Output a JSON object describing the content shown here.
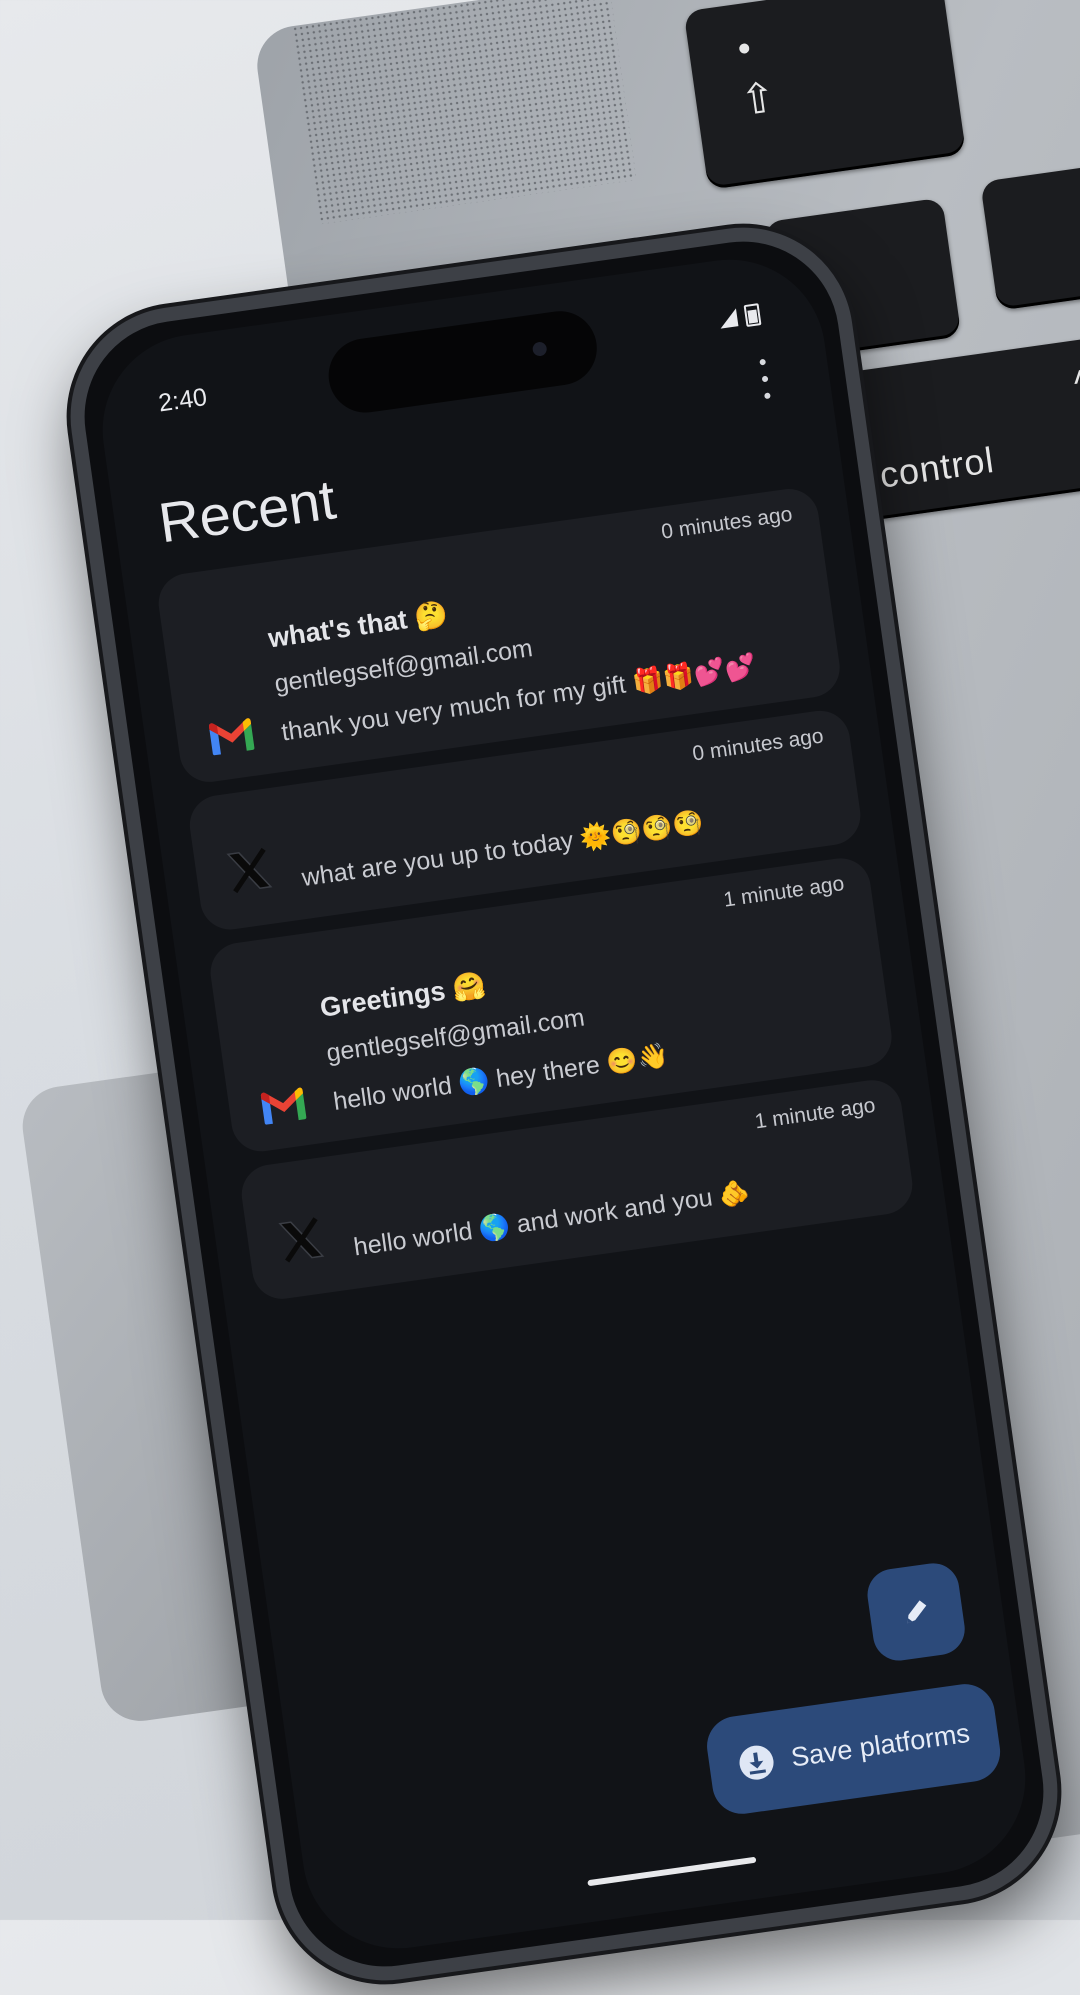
{
  "background": {
    "keyboard": {
      "control_label": "control",
      "caret": "^",
      "shift_arrow": "⇧"
    }
  },
  "status_bar": {
    "time": "2:40"
  },
  "screen": {
    "title": "Recent",
    "messages": [
      {
        "platform": "gmail-icon",
        "time": "0 minutes ago",
        "subject": "what's that 🤔",
        "sender": "gentlegself@gmail.com",
        "body": "thank you very much for my gift 🎁🎁💕💕"
      },
      {
        "platform": "x-icon",
        "time": "0 minutes ago",
        "body": "what are you up to today 🌞🧐🧐🧐"
      },
      {
        "platform": "gmail-icon",
        "time": "1 minute ago",
        "subject": "Greetings 🤗",
        "sender": "gentlegself@gmail.com",
        "body": "hello world 🌎 hey there 😊👋"
      },
      {
        "platform": "x-icon",
        "time": "1 minute ago",
        "body": "hello world 🌎 and work and you 🫵"
      }
    ],
    "save_label": "Save platforms"
  },
  "colors": {
    "screen_bg": "#111317",
    "card_bg": "#1c1e23",
    "fab_bg": "#2c4a7a"
  }
}
